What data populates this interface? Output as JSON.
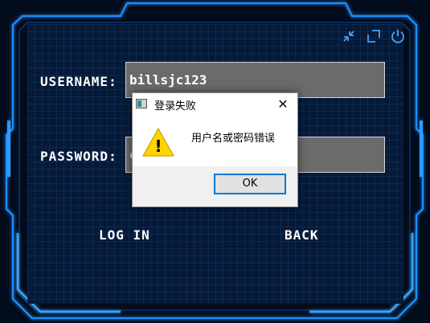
{
  "login": {
    "username_label": "USERNAME:",
    "username_value": "billsjc123",
    "password_label": "PASSWORD:",
    "password_value": "c",
    "login_label": "LOG IN",
    "back_label": "BACK"
  },
  "window_controls": [
    "minimize-icon",
    "maximize-icon",
    "power-icon"
  ],
  "dialog": {
    "title": "登录失败",
    "message": "用户名或密码错误",
    "close_glyph": "✕",
    "ok_label": "OK",
    "warning_glyph": "!"
  },
  "colors": {
    "background": "#030c1c",
    "panel": "#061a38",
    "frame_glow": "#1d8fff",
    "field": "#6b6b6b",
    "dialog_accent": "#0078d7",
    "warning": "#ffd400"
  }
}
